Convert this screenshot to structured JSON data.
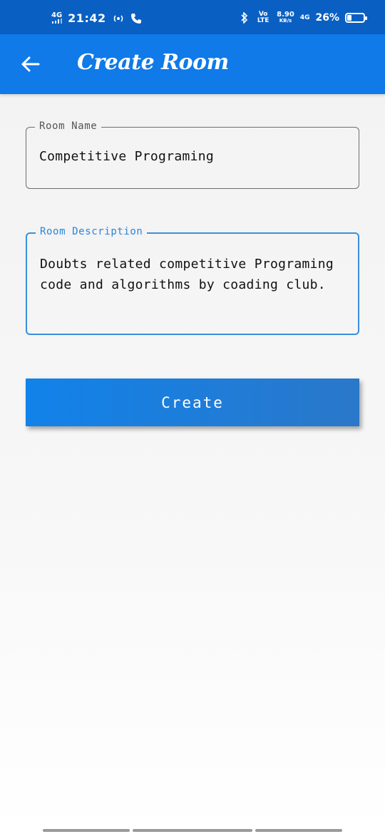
{
  "status_bar": {
    "network_left": "4G",
    "time": "21:42",
    "volte": "Vo LTE",
    "speed_value": "8.90",
    "speed_unit": "KB/s",
    "network_right": "4G",
    "battery_percent": "26%",
    "battery_level": 0.26,
    "icons": [
      "signal-icon",
      "hotspot-icon",
      "phone-icon",
      "bluetooth-icon",
      "battery-icon"
    ]
  },
  "app_bar": {
    "title": "Create Room",
    "back_icon": "arrow-left-icon",
    "color": "#0f7ae8"
  },
  "form": {
    "room_name": {
      "label": "Room Name",
      "value": "Competitive Programing"
    },
    "room_description": {
      "label": "Room Description",
      "value": "Doubts related competitive Programing code and algorithms by coading club."
    },
    "create_button": "Create"
  },
  "colors": {
    "status_bar": "#0a60c2",
    "accent": "#0f7ae8",
    "focused_border": "#3990dc"
  }
}
